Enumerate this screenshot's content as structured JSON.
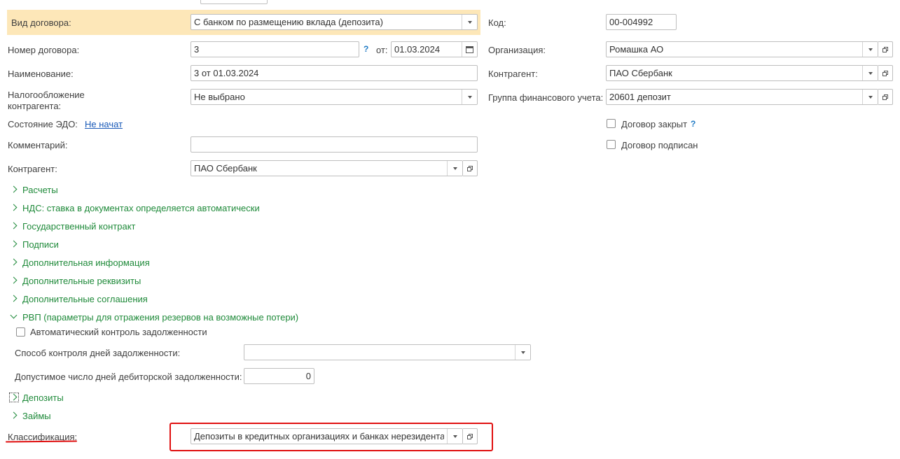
{
  "left": {
    "contract_type": {
      "label": "Вид договора:",
      "value": "С банком по размещению вклада (депозита)"
    },
    "number": {
      "label": "Номер договора:",
      "value": "3",
      "help": "?",
      "date_label": "от:",
      "date_value": "01.03.2024"
    },
    "name": {
      "label": "Наименование:",
      "value": "3 от 01.03.2024"
    },
    "taxation": {
      "label_line1": "Налогообложение",
      "label_line2": "контрагента:",
      "value": "Не выбрано"
    },
    "edo": {
      "label": "Состояние ЭДО:",
      "link": "Не начат"
    },
    "comment": {
      "label": "Комментарий:",
      "value": ""
    },
    "counterparty": {
      "label": "Контрагент:",
      "value": "ПАО Сбербанк"
    }
  },
  "right": {
    "code": {
      "label": "Код:",
      "value": "00-004992"
    },
    "organization": {
      "label": "Организация:",
      "value": "Ромашка АО"
    },
    "counterparty": {
      "label": "Контрагент:",
      "value": "ПАО Сбербанк"
    },
    "fin_group": {
      "label": "Группа финансового учета:",
      "value": "20601 депозит"
    },
    "closed": {
      "label": "Договор закрыт",
      "help": "?",
      "checked": false
    },
    "signed": {
      "label": "Договор подписан",
      "checked": false
    }
  },
  "groups": {
    "payments": "Расчеты",
    "vat": "НДС: ставка в документах определяется автоматически",
    "gov_contract": "Государственный контракт",
    "signatures": "Подписи",
    "additional_info": "Дополнительная информация",
    "additional_details": "Дополнительные реквизиты",
    "additional_agreements": "Дополнительные соглашения",
    "rvp": "РВП (параметры для отражения резервов на возможные потери)",
    "deposits": "Депозиты",
    "loans": "Займы"
  },
  "rvp": {
    "auto_control": {
      "label": "Автоматический контроль задолженности",
      "checked": false
    },
    "control_method": {
      "label": "Способ контроля дней задолженности:",
      "value": ""
    },
    "allowed_days": {
      "label": "Допустимое число дней дебиторской задолженности:",
      "value": "0"
    }
  },
  "classification": {
    "label": "Классификация:",
    "value": "Депозиты в кредитных организациях и банках нерезидентах"
  },
  "colors": {
    "highlight": "#fde7b8",
    "group_green": "#1f8a3a",
    "annotation_red": "#e01010",
    "link_blue": "#1a5ab8"
  }
}
